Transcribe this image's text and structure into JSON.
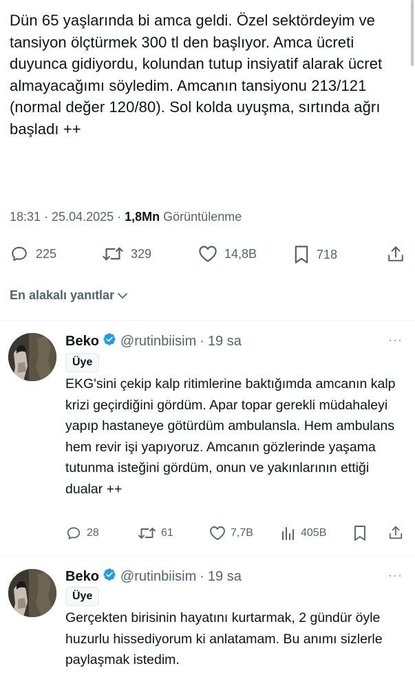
{
  "main_tweet": {
    "text": "Dün 65 yaşlarında bi amca geldi. Özel sektördeyim ve tansiyon ölçtürmek 300 tl den başlıyor. Amca ücreti duyunca gidiyordu, kolundan tutup insiyatif alarak ücret almayacağımı söyledim. Amcanın tansiyonu 213/121 (normal değer 120/80). Sol kolda uyuşma, sırtında ağrı başladı ++",
    "time": "18:31",
    "separator": "·",
    "date": "25.04.2025",
    "views": "1,8Mn",
    "views_label": "Görüntülenme",
    "replies": "225",
    "reposts": "329",
    "likes": "14,8B",
    "bookmarks": "718"
  },
  "sort": {
    "label": "En alakalı yanıtlar"
  },
  "replies": [
    {
      "name": "Beko",
      "handle": "@rutinbiisim",
      "separator": "·",
      "time": "19 sa",
      "more": "···",
      "badge": "Üye",
      "text": "EKG'sini çekip kalp ritimlerine baktığımda amcanın kalp krizi geçirdiğini gördüm. Apar topar gerekli müdahaleyi yapıp hastaneye götürdüm ambulansla. Hem ambulans hem revir işi yapıyoruz. Amcanın gözlerinde yaşama tutunma isteğini gördüm, onun ve yakınlarının ettiği dualar ++",
      "replies": "28",
      "reposts": "61",
      "likes": "7,7B",
      "views": "405B"
    },
    {
      "name": "Beko",
      "handle": "@rutinbiisim",
      "separator": "·",
      "time": "19 sa",
      "more": "···",
      "badge": "Üye",
      "text": "Gerçekten birisinin hayatını kurtarmak, 2 gündür öyle huzurlu hissediyorum ki anlatamam. Bu anımı sizlerle paylaşmak istedim."
    }
  ],
  "icons": {
    "reply": "speech-bubble-icon",
    "repost": "repost-arrows-icon",
    "like": "heart-icon",
    "bookmark": "bookmark-icon",
    "share": "share-upload-icon",
    "views": "bar-chart-icon",
    "verified": "verified-badge-icon",
    "sort": "chevron-down-icon"
  },
  "colors": {
    "text": "#0f1419",
    "secondary": "#536471",
    "verified": "#1d9bf0",
    "divider": "#eff3f4"
  }
}
